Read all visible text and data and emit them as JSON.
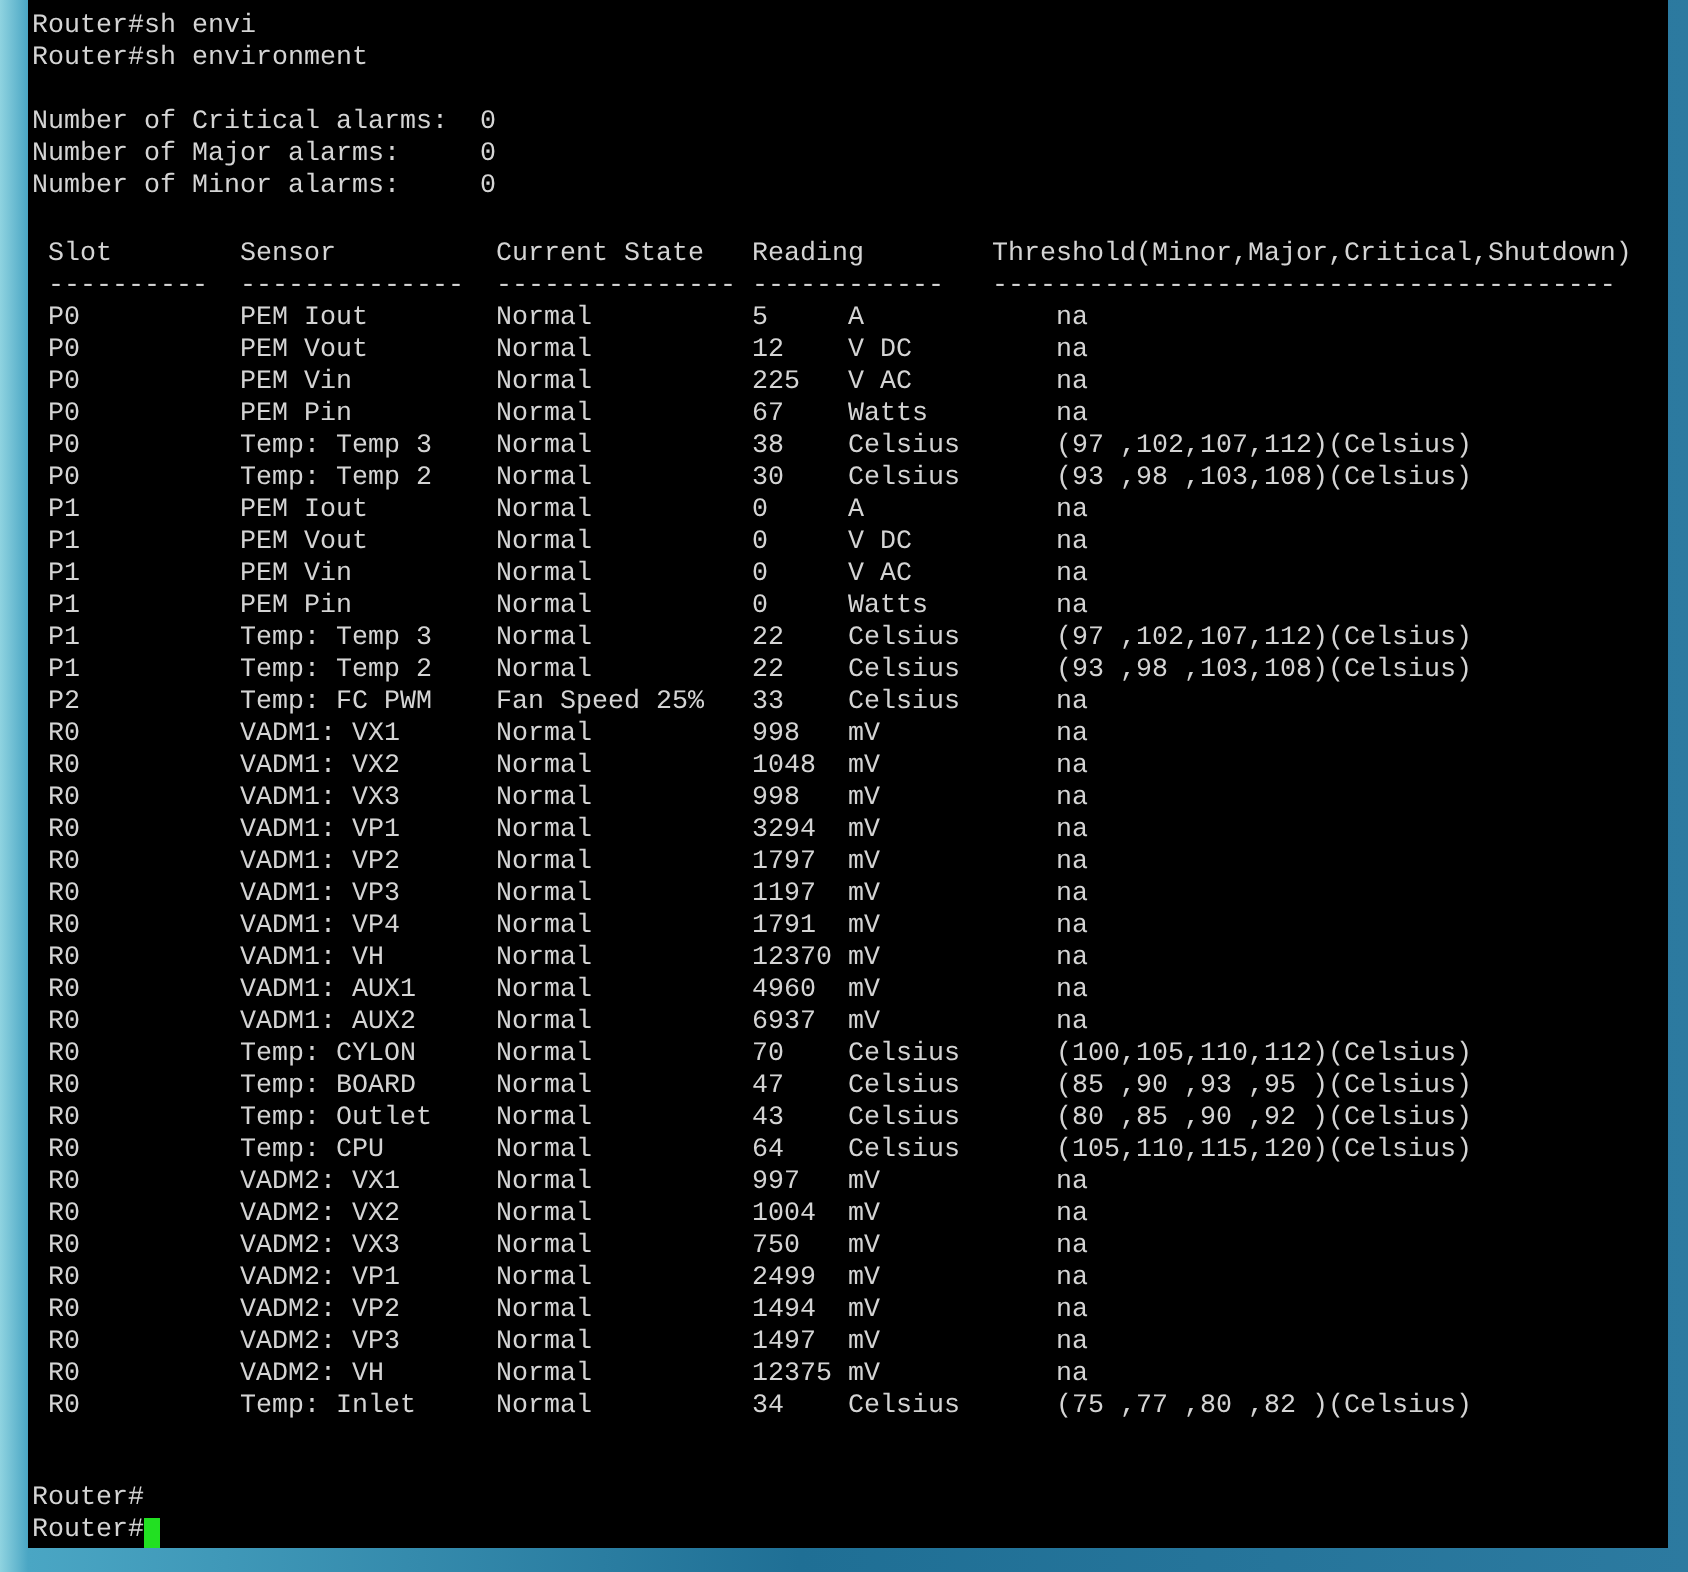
{
  "commands": [
    "Router#sh envi",
    "Router#sh environment"
  ],
  "alarms": [
    {
      "label": "Number of Critical alarms:",
      "value": "0"
    },
    {
      "label": "Number of Major alarms:",
      "value": "0"
    },
    {
      "label": "Number of Minor alarms:",
      "value": "0"
    }
  ],
  "table": {
    "columns": [
      "Slot",
      "Sensor",
      "Current State",
      "Reading",
      "Threshold(Minor,Major,Critical,Shutdown)"
    ],
    "separators": [
      "----------",
      "--------------",
      "---------------",
      "------------",
      "---------------------------------------"
    ],
    "rows": [
      {
        "slot": "P0",
        "sensor": "PEM Iout",
        "state": "Normal",
        "reading": "5",
        "unit": "A",
        "threshold": "na"
      },
      {
        "slot": "P0",
        "sensor": "PEM Vout",
        "state": "Normal",
        "reading": "12",
        "unit": "V DC",
        "threshold": "na"
      },
      {
        "slot": "P0",
        "sensor": "PEM Vin",
        "state": "Normal",
        "reading": "225",
        "unit": "V AC",
        "threshold": "na"
      },
      {
        "slot": "P0",
        "sensor": "PEM Pin",
        "state": "Normal",
        "reading": "67",
        "unit": "Watts",
        "threshold": "na"
      },
      {
        "slot": "P0",
        "sensor": "Temp: Temp 3",
        "state": "Normal",
        "reading": "38",
        "unit": "Celsius",
        "threshold": "(97 ,102,107,112)(Celsius)"
      },
      {
        "slot": "P0",
        "sensor": "Temp: Temp 2",
        "state": "Normal",
        "reading": "30",
        "unit": "Celsius",
        "threshold": "(93 ,98 ,103,108)(Celsius)"
      },
      {
        "slot": "P1",
        "sensor": "PEM Iout",
        "state": "Normal",
        "reading": "0",
        "unit": "A",
        "threshold": "na"
      },
      {
        "slot": "P1",
        "sensor": "PEM Vout",
        "state": "Normal",
        "reading": "0",
        "unit": "V DC",
        "threshold": "na"
      },
      {
        "slot": "P1",
        "sensor": "PEM Vin",
        "state": "Normal",
        "reading": "0",
        "unit": "V AC",
        "threshold": "na"
      },
      {
        "slot": "P1",
        "sensor": "PEM Pin",
        "state": "Normal",
        "reading": "0",
        "unit": "Watts",
        "threshold": "na"
      },
      {
        "slot": "P1",
        "sensor": "Temp: Temp 3",
        "state": "Normal",
        "reading": "22",
        "unit": "Celsius",
        "threshold": "(97 ,102,107,112)(Celsius)"
      },
      {
        "slot": "P1",
        "sensor": "Temp: Temp 2",
        "state": "Normal",
        "reading": "22",
        "unit": "Celsius",
        "threshold": "(93 ,98 ,103,108)(Celsius)"
      },
      {
        "slot": "P2",
        "sensor": "Temp: FC PWM",
        "state": "Fan Speed 25%",
        "reading": "33",
        "unit": "Celsius",
        "threshold": "na"
      },
      {
        "slot": "R0",
        "sensor": "VADM1: VX1",
        "state": "Normal",
        "reading": "998",
        "unit": "mV",
        "threshold": "na"
      },
      {
        "slot": "R0",
        "sensor": "VADM1: VX2",
        "state": "Normal",
        "reading": "1048",
        "unit": "mV",
        "threshold": "na"
      },
      {
        "slot": "R0",
        "sensor": "VADM1: VX3",
        "state": "Normal",
        "reading": "998",
        "unit": "mV",
        "threshold": "na"
      },
      {
        "slot": "R0",
        "sensor": "VADM1: VP1",
        "state": "Normal",
        "reading": "3294",
        "unit": "mV",
        "threshold": "na"
      },
      {
        "slot": "R0",
        "sensor": "VADM1: VP2",
        "state": "Normal",
        "reading": "1797",
        "unit": "mV",
        "threshold": "na"
      },
      {
        "slot": "R0",
        "sensor": "VADM1: VP3",
        "state": "Normal",
        "reading": "1197",
        "unit": "mV",
        "threshold": "na"
      },
      {
        "slot": "R0",
        "sensor": "VADM1: VP4",
        "state": "Normal",
        "reading": "1791",
        "unit": "mV",
        "threshold": "na"
      },
      {
        "slot": "R0",
        "sensor": "VADM1: VH",
        "state": "Normal",
        "reading": "12370",
        "unit": "mV",
        "threshold": "na"
      },
      {
        "slot": "R0",
        "sensor": "VADM1: AUX1",
        "state": "Normal",
        "reading": "4960",
        "unit": "mV",
        "threshold": "na"
      },
      {
        "slot": "R0",
        "sensor": "VADM1: AUX2",
        "state": "Normal",
        "reading": "6937",
        "unit": "mV",
        "threshold": "na"
      },
      {
        "slot": "R0",
        "sensor": "Temp: CYLON",
        "state": "Normal",
        "reading": "70",
        "unit": "Celsius",
        "threshold": "(100,105,110,112)(Celsius)"
      },
      {
        "slot": "R0",
        "sensor": "Temp: BOARD",
        "state": "Normal",
        "reading": "47",
        "unit": "Celsius",
        "threshold": "(85 ,90 ,93 ,95 )(Celsius)"
      },
      {
        "slot": "R0",
        "sensor": "Temp: Outlet",
        "state": "Normal",
        "reading": "43",
        "unit": "Celsius",
        "threshold": "(80 ,85 ,90 ,92 )(Celsius)"
      },
      {
        "slot": "R0",
        "sensor": "Temp: CPU",
        "state": "Normal",
        "reading": "64",
        "unit": "Celsius",
        "threshold": "(105,110,115,120)(Celsius)"
      },
      {
        "slot": "R0",
        "sensor": "VADM2: VX1",
        "state": "Normal",
        "reading": "997",
        "unit": "mV",
        "threshold": "na"
      },
      {
        "slot": "R0",
        "sensor": "VADM2: VX2",
        "state": "Normal",
        "reading": "1004",
        "unit": "mV",
        "threshold": "na"
      },
      {
        "slot": "R0",
        "sensor": "VADM2: VX3",
        "state": "Normal",
        "reading": "750",
        "unit": "mV",
        "threshold": "na"
      },
      {
        "slot": "R0",
        "sensor": "VADM2: VP1",
        "state": "Normal",
        "reading": "2499",
        "unit": "mV",
        "threshold": "na"
      },
      {
        "slot": "R0",
        "sensor": "VADM2: VP2",
        "state": "Normal",
        "reading": "1494",
        "unit": "mV",
        "threshold": "na"
      },
      {
        "slot": "R0",
        "sensor": "VADM2: VP3",
        "state": "Normal",
        "reading": "1497",
        "unit": "mV",
        "threshold": "na"
      },
      {
        "slot": "R0",
        "sensor": "VADM2: VH",
        "state": "Normal",
        "reading": "12375",
        "unit": "mV",
        "threshold": "na"
      },
      {
        "slot": "R0",
        "sensor": "Temp: Inlet",
        "state": "Normal",
        "reading": "34",
        "unit": "Celsius",
        "threshold": "(75 ,77 ,80 ,82 )(Celsius)"
      }
    ]
  },
  "prompts": [
    "Router#",
    "Router#"
  ]
}
